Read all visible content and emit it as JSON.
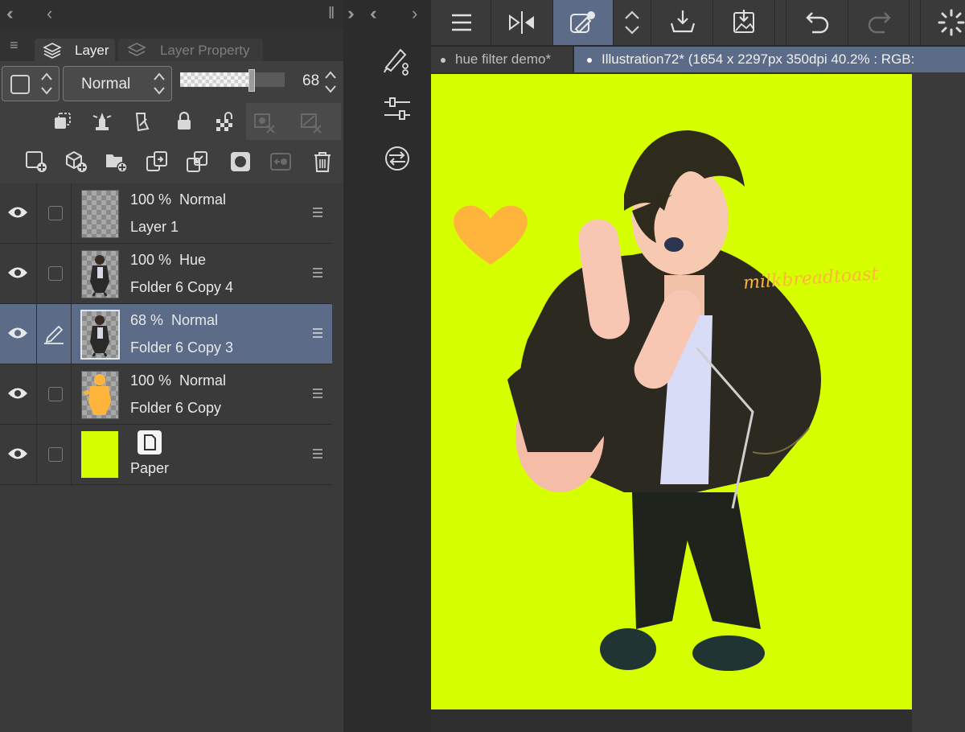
{
  "layer_panel": {
    "tabs": [
      {
        "label": "Layer",
        "active": true
      },
      {
        "label": "Layer Property",
        "active": false
      }
    ],
    "blend_mode": "Normal",
    "opacity_value": "68",
    "opacity_fraction": 0.68,
    "layers": [
      {
        "opacity_mode": "100 %  Normal",
        "name": "Layer 1",
        "visible": true,
        "selected": false,
        "thumb": "transparent"
      },
      {
        "opacity_mode": "100 %  Hue",
        "name": "Folder 6 Copy 4",
        "visible": true,
        "selected": false,
        "thumb": "figure"
      },
      {
        "opacity_mode": "68 %  Normal",
        "name": "Folder 6 Copy 3",
        "visible": true,
        "selected": true,
        "thumb": "figure"
      },
      {
        "opacity_mode": "100 %  Normal",
        "name": "Folder 6 Copy",
        "visible": true,
        "selected": false,
        "thumb": "orange-silhouette"
      },
      {
        "opacity_mode": "",
        "name": "Paper",
        "visible": true,
        "selected": false,
        "thumb": "paper"
      }
    ]
  },
  "document_tabs": [
    {
      "label": "hue filter demo*",
      "active": false
    },
    {
      "label": "Illustration72* (1654 x 2297px 350dpi 40.2% : RGB:",
      "active": true
    }
  ],
  "canvas": {
    "paper_color": "#d6ff00",
    "signature_text": "milkbreadtoast"
  },
  "colors": {
    "selected_row": "#5b6b88",
    "panel_bg": "#3a3a3a",
    "accent_active_tool": "#5b6b88",
    "heart": "#ffb43c"
  }
}
